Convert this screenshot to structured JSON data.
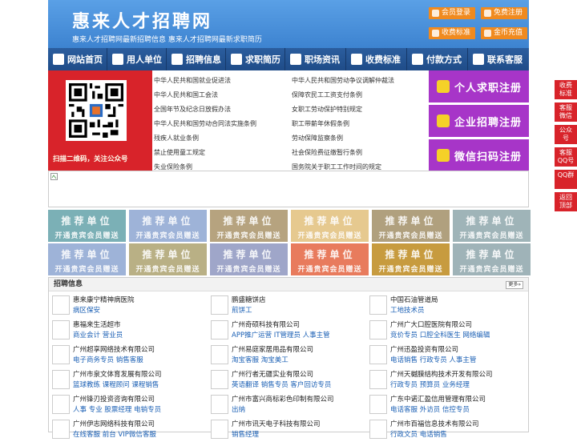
{
  "header": {
    "logo": "惠来人才招聘网",
    "slogan": "惠来人才招聘网最新招聘信息   惠来人才招聘网最新求职简历",
    "buttons": [
      "会员登录",
      "免费注册",
      "收费标准",
      "金币充值"
    ]
  },
  "nav": [
    {
      "label": "网站首页",
      "icon": "home-icon"
    },
    {
      "label": "用人单位",
      "icon": "building-icon"
    },
    {
      "label": "招聘信息",
      "icon": "recruit-icon"
    },
    {
      "label": "求职简历",
      "icon": "resume-icon"
    },
    {
      "label": "职场资讯",
      "icon": "news-icon"
    },
    {
      "label": "收费标准",
      "icon": "coin-icon"
    },
    {
      "label": "付款方式",
      "icon": "payment-icon"
    },
    {
      "label": "联系客服",
      "icon": "service-icon"
    }
  ],
  "qr": {
    "caption": "扫描二维码，关注公众号"
  },
  "laws": [
    [
      "中华人民共和国就业促进法",
      "中华人民共和国劳动争议调解仲裁法"
    ],
    [
      "中华人民共和国工会法",
      "保障农民工工资支付条例"
    ],
    [
      "全国年节及纪念日放假办法",
      "女职工劳动保护特别规定"
    ],
    [
      "中华人民共和国劳动合同法实施条例",
      "职工带薪年休假条例"
    ],
    [
      "残疾人就业条例",
      "劳动保障监察条例"
    ],
    [
      "禁止使用童工规定",
      "社会保险费征缴暂行条例"
    ],
    [
      "失业保险条例",
      "国务院关于职工工作时间的规定"
    ]
  ],
  "register": [
    "个人求职注册",
    "企业招聘注册",
    "微信扫码注册"
  ],
  "recommend": {
    "title": "推荐单位",
    "subtitle": "开通贵宾会员赠送"
  },
  "tile_colors": [
    "#7bb0b6",
    "#9eb3d8",
    "#b6a37f",
    "#e6c98f",
    "#b0a07e",
    "#9fb4b8",
    "#9eb3d8",
    "#b9b085",
    "#9fa6c9",
    "#e87b5d",
    "#c79b3f",
    "#9fb3b8"
  ],
  "jobs": {
    "title": "招聘信息",
    "more": "更多»",
    "items": [
      {
        "company": "惠来康宁精神病医院",
        "positions": "病区保安"
      },
      {
        "company": "鹏盛糖饼店",
        "positions": "煎饼工"
      },
      {
        "company": "中国石油管道局",
        "positions": "工地技术员"
      },
      {
        "company": "惠福来生活超市",
        "positions": "商业会计 营业员"
      },
      {
        "company": "广州奇硕科技有限公司",
        "positions": "APP推广运营 IT管理员 人事主管"
      },
      {
        "company": "广州广大口腔医院有限公司",
        "positions": "竞价专员 口腔全科医生 网络编辑"
      },
      {
        "company": "广州超享网络技术有限公司",
        "positions": "电子商务专员 销售客服"
      },
      {
        "company": "广州易庭家居用品有限公司",
        "positions": "淘宝客服 淘宝美工"
      },
      {
        "company": "广州迅盈投资有限公司",
        "positions": "电话销售 行政专员 人事主管"
      },
      {
        "company": "广州市泉文体育发展有限公司",
        "positions": "篮球教练 课程顾问 课程销售"
      },
      {
        "company": "广州行者无疆实业有限公司",
        "positions": "英语翻译 销售专员 客户回访专员"
      },
      {
        "company": "广州天樾膜结构技术开发有限公司",
        "positions": "行政专员 预算员 业务经理"
      },
      {
        "company": "广州锋刃投资咨询有限公司",
        "positions": "人事 专业 股票经理 电销专员"
      },
      {
        "company": "广州市富兴商标彩色印制有限公司",
        "positions": "出纳"
      },
      {
        "company": "广东中诺汇盈信用管理有限公司",
        "positions": "电话客服 外访员 信控专员"
      },
      {
        "company": "广州伊志网络科技有限公司",
        "positions": "在线客服 前台 VIP微信客服"
      },
      {
        "company": "广州市讯天电子科技有限公司",
        "positions": "销售经理"
      },
      {
        "company": "广州市百福信息技术有限公司",
        "positions": "行政文员 电话销售"
      }
    ]
  },
  "side": [
    "收费标准",
    "客服微信",
    "公众号",
    "客服QQ号",
    "QQ群",
    "返回顶部"
  ]
}
